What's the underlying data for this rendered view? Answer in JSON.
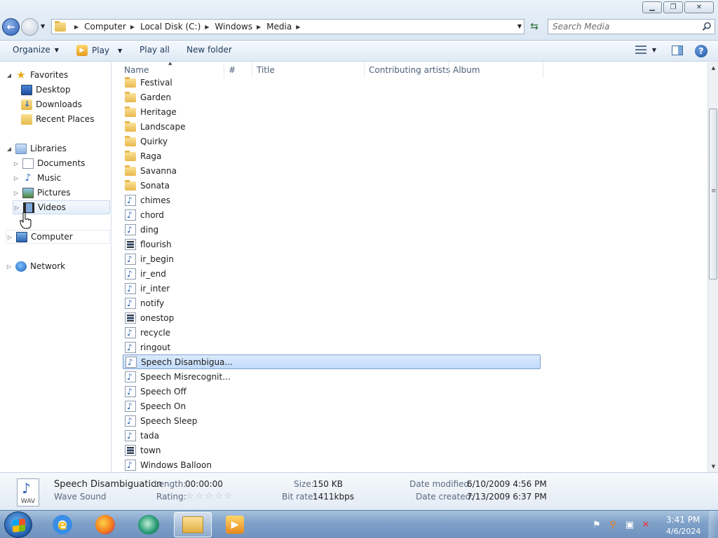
{
  "address": {
    "crumbs": [
      "Computer",
      "Local Disk (C:)",
      "Windows",
      "Media"
    ]
  },
  "search": {
    "placeholder": "Search Media"
  },
  "toolbar": {
    "organize": "Organize",
    "play": "Play",
    "play_all": "Play all",
    "new_folder": "New folder"
  },
  "nav": {
    "favorites": "Favorites",
    "desktop": "Desktop",
    "downloads": "Downloads",
    "recent_places": "Recent Places",
    "libraries": "Libraries",
    "documents": "Documents",
    "music": "Music",
    "pictures": "Pictures",
    "videos": "Videos",
    "computer": "Computer",
    "network": "Network"
  },
  "columns": {
    "name": "Name",
    "number": "#",
    "title": "Title",
    "contributing_artists": "Contributing artists",
    "album": "Album"
  },
  "files": [
    {
      "name": "Festival",
      "kind": "folder"
    },
    {
      "name": "Garden",
      "kind": "folder"
    },
    {
      "name": "Heritage",
      "kind": "folder"
    },
    {
      "name": "Landscape",
      "kind": "folder"
    },
    {
      "name": "Quirky",
      "kind": "folder"
    },
    {
      "name": "Raga",
      "kind": "folder"
    },
    {
      "name": "Savanna",
      "kind": "folder"
    },
    {
      "name": "Sonata",
      "kind": "folder"
    },
    {
      "name": "chimes",
      "kind": "audio"
    },
    {
      "name": "chord",
      "kind": "audio"
    },
    {
      "name": "ding",
      "kind": "audio"
    },
    {
      "name": "flourish",
      "kind": "midi"
    },
    {
      "name": "ir_begin",
      "kind": "audio"
    },
    {
      "name": "ir_end",
      "kind": "audio"
    },
    {
      "name": "ir_inter",
      "kind": "audio"
    },
    {
      "name": "notify",
      "kind": "audio"
    },
    {
      "name": "onestop",
      "kind": "midi"
    },
    {
      "name": "recycle",
      "kind": "audio"
    },
    {
      "name": "ringout",
      "kind": "audio"
    },
    {
      "name": "Speech Disambigua...",
      "kind": "audio",
      "selected": true
    },
    {
      "name": "Speech Misrecognit...",
      "kind": "audio"
    },
    {
      "name": "Speech Off",
      "kind": "audio"
    },
    {
      "name": "Speech On",
      "kind": "audio"
    },
    {
      "name": "Speech Sleep",
      "kind": "audio"
    },
    {
      "name": "tada",
      "kind": "audio"
    },
    {
      "name": "town",
      "kind": "midi"
    },
    {
      "name": "Windows Balloon",
      "kind": "audio"
    }
  ],
  "details": {
    "icon_ext": "WAV",
    "name": "Speech Disambiguation",
    "type": "Wave Sound",
    "length_label": "Length:",
    "length": "00:00:00",
    "rating_label": "Rating:",
    "rating_stars": 0,
    "size_label": "Size:",
    "size": "150 KB",
    "bitrate_label": "Bit rate:",
    "bitrate": "1411kbps",
    "modified_label": "Date modified:",
    "modified": "6/10/2009 4:56 PM",
    "created_label": "Date created:",
    "created": "7/13/2009 6:37 PM"
  },
  "taskbar": {
    "time": "3:41 PM",
    "date": "4/6/2024"
  }
}
